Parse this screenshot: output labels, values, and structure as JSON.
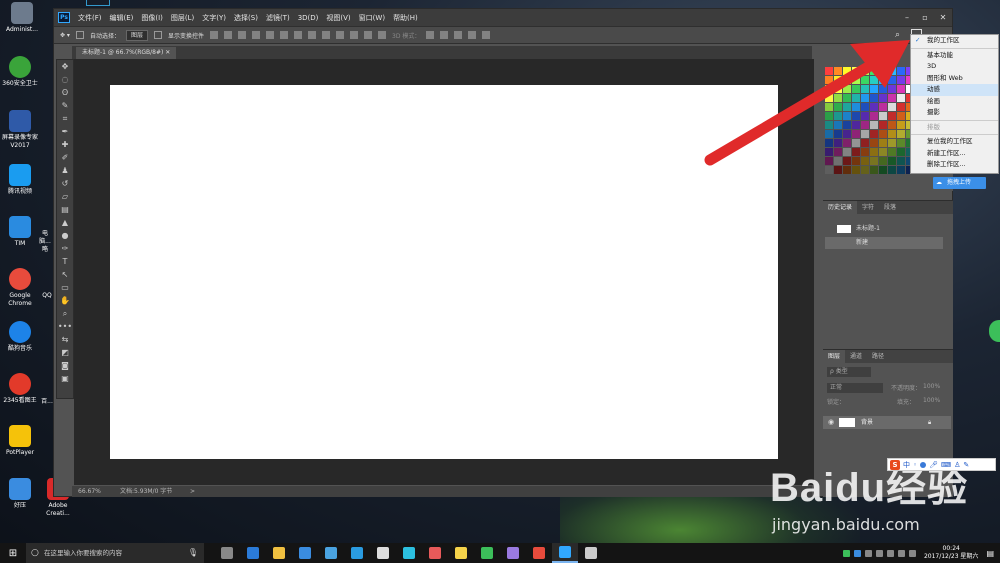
{
  "desktop": {
    "icons": [
      {
        "label": "Administ...",
        "color": "#6d7b8d"
      },
      {
        "label": "360安全卫士",
        "color": "#3aa43a"
      },
      {
        "label": "屏幕录像专家V2017",
        "color": "#2f5aa8"
      },
      {
        "label": "腾讯视频",
        "color": "#1a9cf0"
      },
      {
        "label": "TIM",
        "color": "#2a8be0"
      },
      {
        "label": "Google Chrome",
        "color": "#e84b3c"
      },
      {
        "label": "酷狗音乐",
        "color": "#1d83e8"
      },
      {
        "label": "2345看图王",
        "color": "#e23a2a"
      },
      {
        "label": "PotPlayer",
        "color": "#f5c20a"
      },
      {
        "label": "好压",
        "color": "#3a8ce0"
      }
    ],
    "col2": [
      {
        "label": "电脑...略"
      },
      {
        "label": "QQ"
      },
      {
        "label": "百..."
      },
      {
        "label": "Adobe Creati..."
      }
    ]
  },
  "photoshop": {
    "menu": [
      "文件(F)",
      "编辑(E)",
      "图像(I)",
      "图层(L)",
      "文字(Y)",
      "选择(S)",
      "滤镜(T)",
      "3D(D)",
      "视图(V)",
      "窗口(W)",
      "帮助(H)"
    ],
    "options": {
      "auto_select": "自动选择：",
      "group": "图层",
      "show_transform": "显示变换控件",
      "mode_3d": "3D 模式："
    },
    "doc_tab": "未标题-1 @ 66.7%(RGB/8#)",
    "status_zoom": "66.67%",
    "status_doc": "文档:5.93M/0 字节",
    "status_arrow": ">",
    "history_tabs": [
      "历史记录",
      "字符",
      "段落"
    ],
    "history_items": [
      "未标题-1",
      "新建"
    ],
    "layers_tabs": [
      "图层",
      "通道",
      "路径"
    ],
    "layers": {
      "kind": "ρ 类型",
      "mode": "正常",
      "opacity_label": "不透明度：",
      "opacity": "100%",
      "lock_label": "锁定：",
      "fill_label": "填充：",
      "fill": "100%",
      "layer_name": "背景"
    }
  },
  "workspace_menu": {
    "items": [
      {
        "label": "我的工作区",
        "checked": true,
        "state": "normal"
      },
      {
        "label": "基本功能",
        "state": "normal"
      },
      {
        "label": "3D",
        "state": "normal"
      },
      {
        "label": "图形和 Web",
        "state": "normal"
      },
      {
        "label": "动感",
        "state": "highlight"
      },
      {
        "label": "绘画",
        "state": "normal"
      },
      {
        "label": "摄影",
        "state": "normal"
      },
      {
        "label": "排版",
        "state": "disabled"
      },
      {
        "label": "复位我的工作区",
        "state": "normal"
      },
      {
        "label": "新建工作区...",
        "state": "normal"
      },
      {
        "label": "删除工作区...",
        "state": "normal"
      }
    ],
    "upload_label": "拖拽上传"
  },
  "watermark": {
    "brand": "Baidu经验",
    "url": "jingyan.baidu.com"
  },
  "ime": {
    "s": "S",
    "lang": "中"
  },
  "taskbar": {
    "search_placeholder": "在这里输入你要搜索的内容",
    "time": "00:24",
    "date": "2017/12/23 星期六",
    "apps": [
      {
        "name": "task-view",
        "color": "#888"
      },
      {
        "name": "edge",
        "color": "#2b7bd8"
      },
      {
        "name": "file-explorer",
        "color": "#f0c040"
      },
      {
        "name": "store",
        "color": "#3a8ce0"
      },
      {
        "name": "security",
        "color": "#4aa3e0"
      },
      {
        "name": "qq-browser",
        "color": "#2a9be0"
      },
      {
        "name": "mail",
        "color": "#ddd"
      },
      {
        "name": "player",
        "color": "#2cc0e0"
      },
      {
        "name": "photo",
        "color": "#e85a5a"
      },
      {
        "name": "notepad",
        "color": "#f5d34a"
      },
      {
        "name": "wechat",
        "color": "#3cbf5a"
      },
      {
        "name": "after-effects",
        "color": "#9a7ae0"
      },
      {
        "name": "chrome",
        "color": "#e84b3c"
      },
      {
        "name": "photoshop",
        "color": "#31a8ff"
      },
      {
        "name": "recorder",
        "color": "#ccc"
      }
    ]
  }
}
